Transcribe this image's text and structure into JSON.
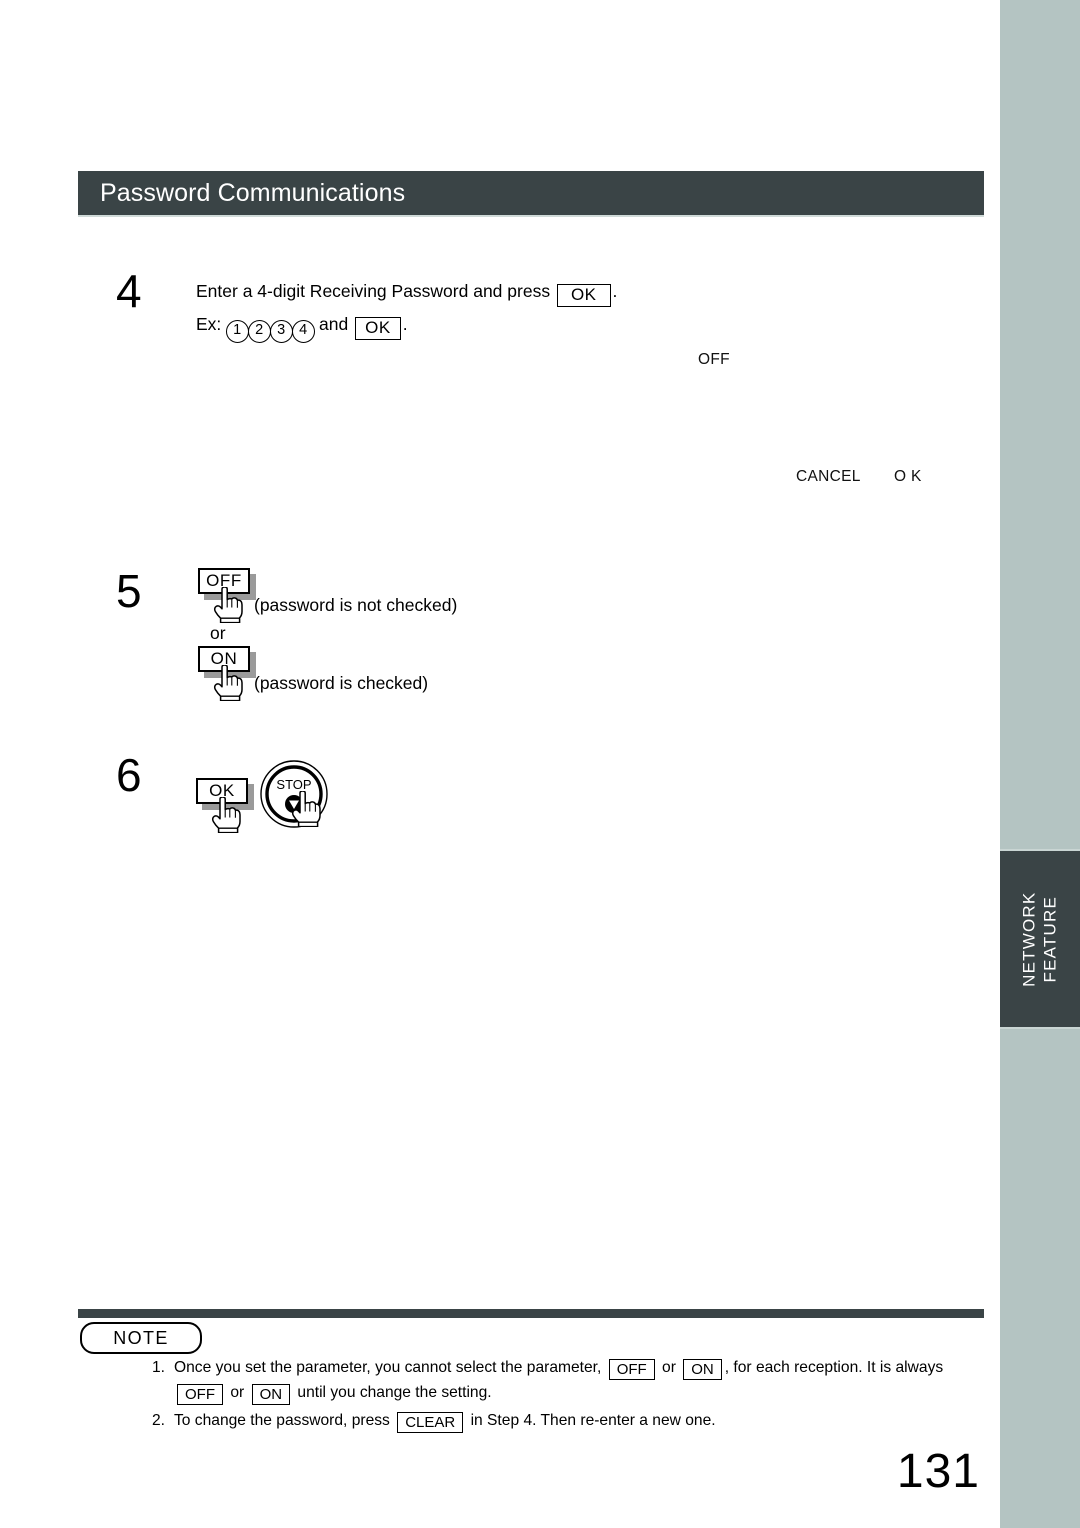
{
  "page": {
    "number": "131",
    "side_tab": {
      "line1": "NETWORK",
      "line2": "FEATURE"
    }
  },
  "header": {
    "title": "Password Communications"
  },
  "steps": [
    {
      "number": "4",
      "line1_before": "Enter a 4-digit Receiving Password and press",
      "line1_key": "OK",
      "line1_after": ".",
      "line2_prefix": "Ex:",
      "line2_digits": [
        "1",
        "2",
        "3",
        "4"
      ],
      "line2_mid": "and",
      "line2_key": "OK",
      "line2_after": "."
    },
    {
      "number": "5",
      "button_off": "OFF",
      "caption_off": "(password is not checked)",
      "or_label": "or",
      "button_on": "ON",
      "caption_on": "(password is checked)"
    },
    {
      "number": "6",
      "button_ok": "OK",
      "button_stop": "STOP"
    }
  ],
  "lcd": {
    "mode_value": "OFF",
    "softkey_cancel": "CANCEL",
    "softkey_ok": "O K"
  },
  "note": {
    "badge": "NOTE",
    "items": [
      {
        "marker": "1.",
        "part1": "Once you set the parameter, you cannot select the parameter,",
        "key1": "OFF",
        "conj1": "or",
        "key2": "ON",
        "part2": ", for each reception.  It is always",
        "key3": "OFF",
        "conj2": "or",
        "key4": "ON",
        "part3": "until you change the setting."
      },
      {
        "marker": "2.",
        "part1": "To change the password, press",
        "key1": "CLEAR",
        "part2": "in Step 4. Then re-enter a new one."
      }
    ]
  },
  "colors": {
    "header_bar": "#3a4446",
    "edge_band": "#b4c4c2",
    "rule": "#3a4446"
  }
}
